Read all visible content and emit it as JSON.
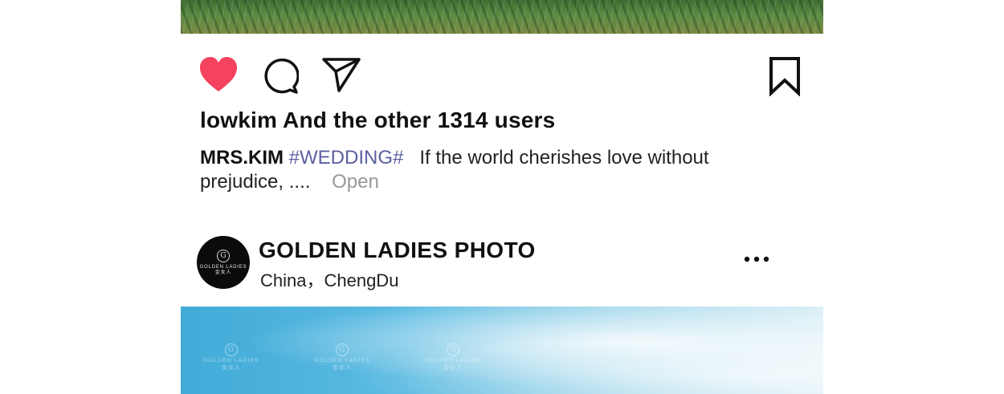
{
  "post": {
    "likes_text": "lowkim And the other 1314 users",
    "caption": {
      "author": "MRS.KIM",
      "hashtag": "#WEDDING#",
      "text": "If the world cherishes love without prejudice, ....",
      "open_label": "Open"
    },
    "icons": {
      "like": "heart-icon",
      "comment": "comment-icon",
      "share": "send-icon",
      "save": "bookmark-icon",
      "more": "more-icon"
    },
    "colors": {
      "like": "#f5425f",
      "hashtag": "#5b5fa0",
      "open": "#999999"
    }
  },
  "next_post": {
    "account_name": "GOLDEN LADIES PHOTO",
    "location": "China，ChengDu",
    "avatar": {
      "mark": "G",
      "brand": "GOLDEN LADIES",
      "sub": "金女人"
    },
    "watermark": {
      "mark": "G",
      "brand": "GOLDEN LADIES",
      "sub": "金女人"
    }
  }
}
